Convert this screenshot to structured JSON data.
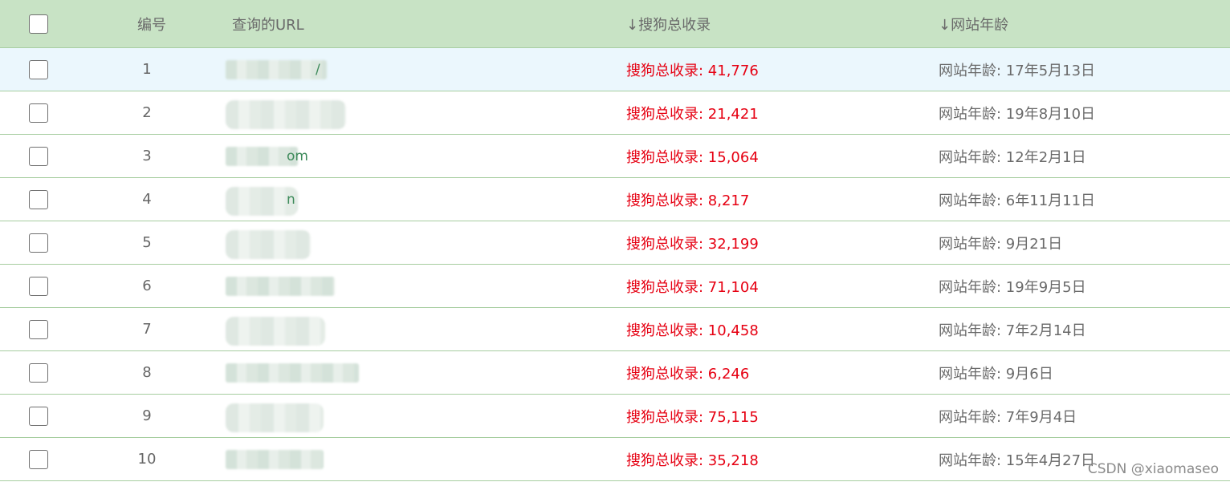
{
  "table": {
    "headers": {
      "number": "编号",
      "url": "查询的URL",
      "sogou": "↓搜狗总收录",
      "age": "↓网站年龄"
    },
    "rows": [
      {
        "num": "1",
        "url_visible": "/",
        "sogou": "搜狗总收录: 41,776",
        "age": "网站年龄: 17年5月13日",
        "highlighted": true
      },
      {
        "num": "2",
        "url_visible": "",
        "sogou": "搜狗总收录: 21,421",
        "age": "网站年龄: 19年8月10日",
        "highlighted": false
      },
      {
        "num": "3",
        "url_visible": "om",
        "sogou": "搜狗总收录: 15,064",
        "age": "网站年龄: 12年2月1日",
        "highlighted": false
      },
      {
        "num": "4",
        "url_visible": "n",
        "sogou": "搜狗总收录: 8,217",
        "age": "网站年龄: 6年11月11日",
        "highlighted": false
      },
      {
        "num": "5",
        "url_visible": "",
        "sogou": "搜狗总收录: 32,199",
        "age": "网站年龄: 9月21日",
        "highlighted": false
      },
      {
        "num": "6",
        "url_visible": "",
        "sogou": "搜狗总收录: 71,104",
        "age": "网站年龄: 19年9月5日",
        "highlighted": false
      },
      {
        "num": "7",
        "url_visible": "",
        "sogou": "搜狗总收录: 10,458",
        "age": "网站年龄: 7年2月14日",
        "highlighted": false
      },
      {
        "num": "8",
        "url_visible": "",
        "sogou": "搜狗总收录: 6,246",
        "age": "网站年龄: 9月6日",
        "highlighted": false
      },
      {
        "num": "9",
        "url_visible": "",
        "sogou": "搜狗总收录: 75,115",
        "age": "网站年龄: 7年9月4日",
        "highlighted": false
      },
      {
        "num": "10",
        "url_visible": "",
        "sogou": "搜狗总收录: 35,218",
        "age": "网站年龄: 15年4月27日",
        "highlighted": false
      }
    ]
  },
  "watermark": "CSDN @xiaomaseo",
  "colors": {
    "header_bg": "#c8e3c5",
    "row_border": "#a6cd9f",
    "highlight_bg": "#ebf7fd",
    "sogou_text": "#e60012",
    "body_text": "#666666"
  }
}
